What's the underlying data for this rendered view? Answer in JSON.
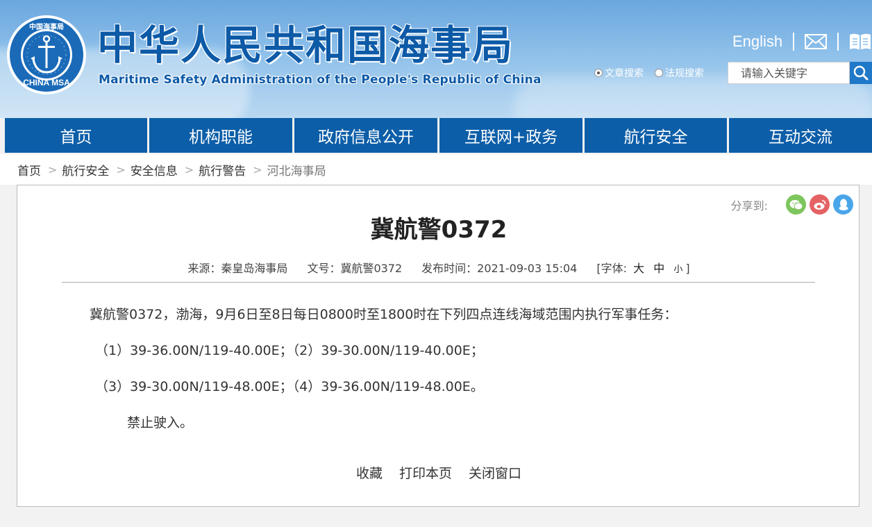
{
  "header": {
    "title": "中华人民共和国海事局",
    "subtitle": "Maritime Safety Administration of the People's Republic of China",
    "logo_text": "CHINA MSA",
    "logo_ring_text": "中国海事局",
    "lang_link": "English",
    "icons": [
      "mail-icon",
      "book-icon",
      "search-icon"
    ]
  },
  "search": {
    "option_article": "文章搜索",
    "option_law": "法规搜索",
    "selected": "文章搜索",
    "placeholder": "请输入关键字"
  },
  "nav": {
    "items": [
      "首页",
      "机构职能",
      "政府信息公开",
      "互联网+政务",
      "航行安全",
      "互动交流"
    ]
  },
  "breadcrumb": [
    "首页",
    "航行安全",
    "安全信息",
    "航行警告",
    "河北海事局"
  ],
  "share": {
    "label": "分享到:",
    "icons": [
      "wechat-icon",
      "weibo-icon",
      "qq-icon"
    ]
  },
  "article": {
    "title": "冀航警0372",
    "source": "来源：秦皇岛海事局",
    "doc_no": "文号：冀航警0372",
    "publish_time": "发布时间：2021-09-03 15:04",
    "font_label": "[字体:",
    "font_large": "大",
    "font_medium": "中",
    "font_small": "小",
    "font_close": "]",
    "paragraphs": [
      "冀航警0372，渤海，9月6日至8日每日0800时至1800时在下列四点连线海域范围内执行军事任务：",
      "（1）39-36.00N/119-40.00E；（2）39-30.00N/119-40.00E；",
      "（3）39-30.00N/119-48.00E；（4）39-36.00N/119-48.00E。",
      "禁止驶入。"
    ]
  },
  "actions": {
    "favorite": "收藏",
    "print": "打印本页",
    "close": "关闭窗口"
  },
  "colors": {
    "nav_bg": "#0c5ea8",
    "title_blue": "#0d5aa7",
    "search_btn": "#1f78c8",
    "wechat": "#7dc55d",
    "weibo": "#e46264",
    "qq": "#4aa6ea"
  }
}
